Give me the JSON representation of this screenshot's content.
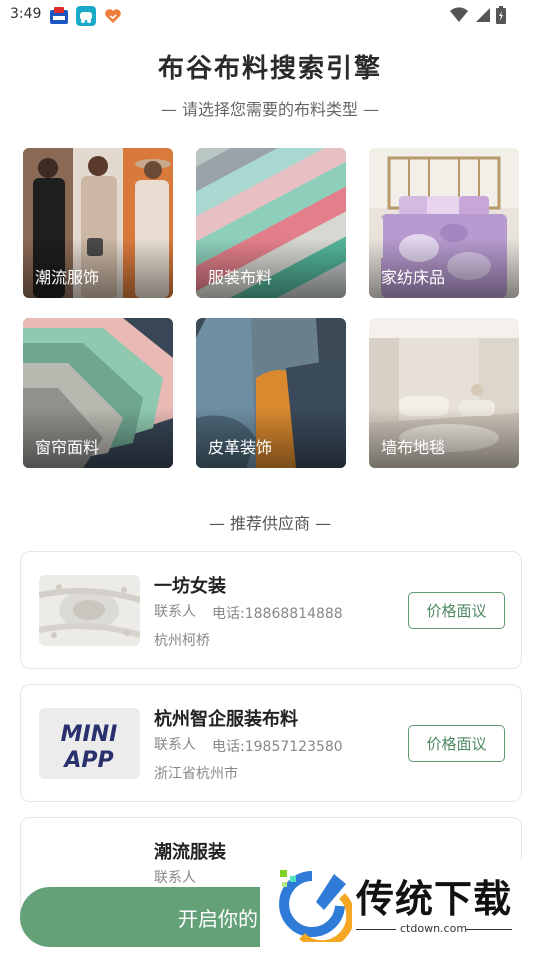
{
  "status_bar": {
    "time": "3:49",
    "icons": [
      "weather-app-icon",
      "car-app-icon",
      "heart-app-icon"
    ],
    "right_icons": [
      "wifi-icon",
      "signal-icon",
      "battery-icon"
    ]
  },
  "header": {
    "title": "布谷布料搜索引擎",
    "subtitle": "— 请选择您需要的布料类型 —"
  },
  "categories": [
    {
      "label": "潮流服饰"
    },
    {
      "label": "服装布料"
    },
    {
      "label": "家纺床品"
    },
    {
      "label": "窗帘面料"
    },
    {
      "label": "皮革装饰"
    },
    {
      "label": "墙布地毯"
    }
  ],
  "suppliers_section": {
    "title": "— 推荐供应商 —",
    "items": [
      {
        "name": "一坊女装",
        "contact": "联系人",
        "phone": "电话:18868814888",
        "location": "杭州柯桥",
        "button": "价格面议"
      },
      {
        "name": "杭州智企服装布料",
        "contact": "联系人",
        "phone": "电话:19857123580",
        "location": "浙江省杭州市",
        "button": "价格面议",
        "thumb_text_1": "MINI",
        "thumb_text_2": "APP"
      },
      {
        "name": "潮流服装",
        "contact": "联系人",
        "phone": "",
        "location": "",
        "button": ""
      }
    ]
  },
  "cta": {
    "label": "开启你的"
  },
  "watermark": {
    "brand": "传统下载",
    "url": "ctdown.com"
  },
  "colors": {
    "accent": "#64a178",
    "button_border": "#5e9a71"
  }
}
